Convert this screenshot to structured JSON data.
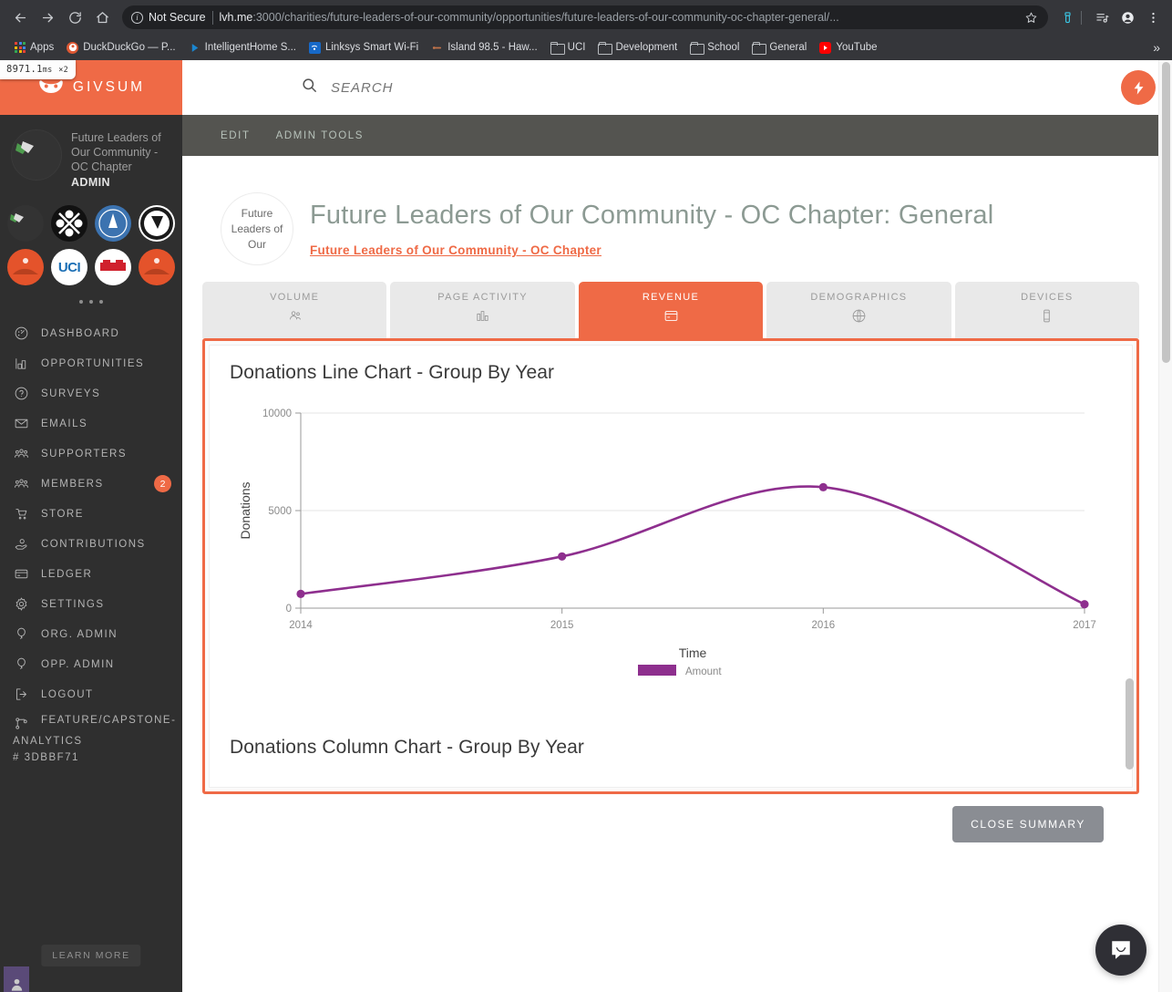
{
  "browser": {
    "security_label": "Not Secure",
    "url_host": "lvh.me",
    "url_rest": ":3000/charities/future-leaders-of-our-community/opportunities/future-leaders-of-our-community-oc-chapter-general/...",
    "back_icon": "back-arrow-icon",
    "forward_icon": "forward-arrow-icon",
    "reload_icon": "reload-icon",
    "home_icon": "home-icon",
    "bookmarks": [
      {
        "label": "Apps",
        "icon": "apps-grid-icon"
      },
      {
        "label": "DuckDuckGo — P...",
        "icon": "duckduckgo-icon"
      },
      {
        "label": "IntelligentHome S...",
        "icon": "play-triangle-icon"
      },
      {
        "label": "Linksys Smart Wi-Fi",
        "icon": "wifi-icon"
      },
      {
        "label": "Island 98.5 - Haw...",
        "icon": "radio-icon"
      },
      {
        "label": "UCI",
        "icon": "folder-icon"
      },
      {
        "label": "Development",
        "icon": "folder-icon"
      },
      {
        "label": "School",
        "icon": "folder-icon"
      },
      {
        "label": "General",
        "icon": "folder-icon"
      },
      {
        "label": "YouTube",
        "icon": "youtube-icon"
      }
    ],
    "overflow_label": "»"
  },
  "perf_badge": {
    "value": "8971.1",
    "unit": "ms",
    "count": "×2"
  },
  "sidebar": {
    "brand": "GIVSUM",
    "org_name": "Future Leaders of Our Community - OC Chapter",
    "org_role": "ADMIN",
    "org_switcher": [
      {
        "name": "current-org-avatar"
      },
      {
        "name": "org-avatar-cross-hearts"
      },
      {
        "name": "org-avatar-blue-seal"
      },
      {
        "name": "org-avatar-black-seal"
      },
      {
        "name": "org-avatar-orange-hands"
      },
      {
        "name": "org-avatar-uci",
        "text": "UCI"
      },
      {
        "name": "org-avatar-red-logo"
      },
      {
        "name": "org-avatar-orange-hands-2"
      }
    ],
    "items": [
      {
        "label": "DASHBOARD",
        "icon": "dashboard-icon"
      },
      {
        "label": "OPPORTUNITIES",
        "icon": "opportunities-icon"
      },
      {
        "label": "SURVEYS",
        "icon": "question-circle-icon"
      },
      {
        "label": "EMAILS",
        "icon": "envelope-icon"
      },
      {
        "label": "SUPPORTERS",
        "icon": "people-icon"
      },
      {
        "label": "MEMBERS",
        "icon": "people-icon",
        "badge": "2"
      },
      {
        "label": "STORE",
        "icon": "cart-icon"
      },
      {
        "label": "CONTRIBUTIONS",
        "icon": "hand-coin-icon"
      },
      {
        "label": "LEDGER",
        "icon": "credit-card-icon"
      },
      {
        "label": "SETTINGS",
        "icon": "gear-icon"
      },
      {
        "label": "ORG. ADMIN",
        "icon": "balloon-icon"
      },
      {
        "label": "OPP. ADMIN",
        "icon": "balloon-icon"
      },
      {
        "label": "LOGOUT",
        "icon": "logout-icon"
      }
    ],
    "branch": {
      "icon": "git-branch-icon",
      "line1": "FEATURE/CAPSTONE-",
      "line2": "ANALYTICS",
      "line3": "# 3DBBF71"
    },
    "learn_more": "LEARN MORE",
    "bottom_avatar": "user-avatar-icon"
  },
  "topbar": {
    "search_placeholder": "SEARCH",
    "search_value": "",
    "search_icon": "search-icon",
    "action_icon": "lightning-bolt-icon"
  },
  "adminbar": {
    "edit": "EDIT",
    "admin_tools": "ADMIN TOOLS"
  },
  "page": {
    "logo_text": "Future Leaders of Our",
    "title": "Future Leaders of Our Community - OC Chapter: General",
    "breadcrumb": "Future Leaders of Our Community - OC Chapter"
  },
  "tabs": [
    {
      "label": "VOLUME",
      "icon": "people-icon",
      "active": false
    },
    {
      "label": "PAGE ACTIVITY",
      "icon": "bar-chart-icon",
      "active": false
    },
    {
      "label": "REVENUE",
      "icon": "credit-card-icon",
      "active": true
    },
    {
      "label": "DEMOGRAPHICS",
      "icon": "globe-icon",
      "active": false
    },
    {
      "label": "DEVICES",
      "icon": "mobile-icon",
      "active": false
    }
  ],
  "second_chart_title": "Donations Column Chart - Group By Year",
  "close_summary_label": "CLOSE SUMMARY",
  "colors": {
    "brand_orange": "#ef6a46",
    "series_purple": "#8e2f8e",
    "sidebar_dark": "#2f2f2f",
    "admin_bar": "#545450",
    "title_gray": "#8c9a93"
  },
  "chart_data": {
    "type": "line",
    "title": "Donations Line Chart - Group By Year",
    "xlabel": "Time",
    "ylabel": "Donations",
    "categories": [
      "2014",
      "2015",
      "2016",
      "2017"
    ],
    "series": [
      {
        "name": "Amount",
        "color": "#8e2f8e",
        "values": [
          730,
          2650,
          6200,
          200
        ]
      }
    ],
    "ylim": [
      0,
      10000
    ],
    "yticks": [
      0,
      5000,
      10000
    ],
    "grid": true,
    "legend_position": "bottom",
    "legend": [
      "Amount"
    ],
    "smooth": true
  }
}
